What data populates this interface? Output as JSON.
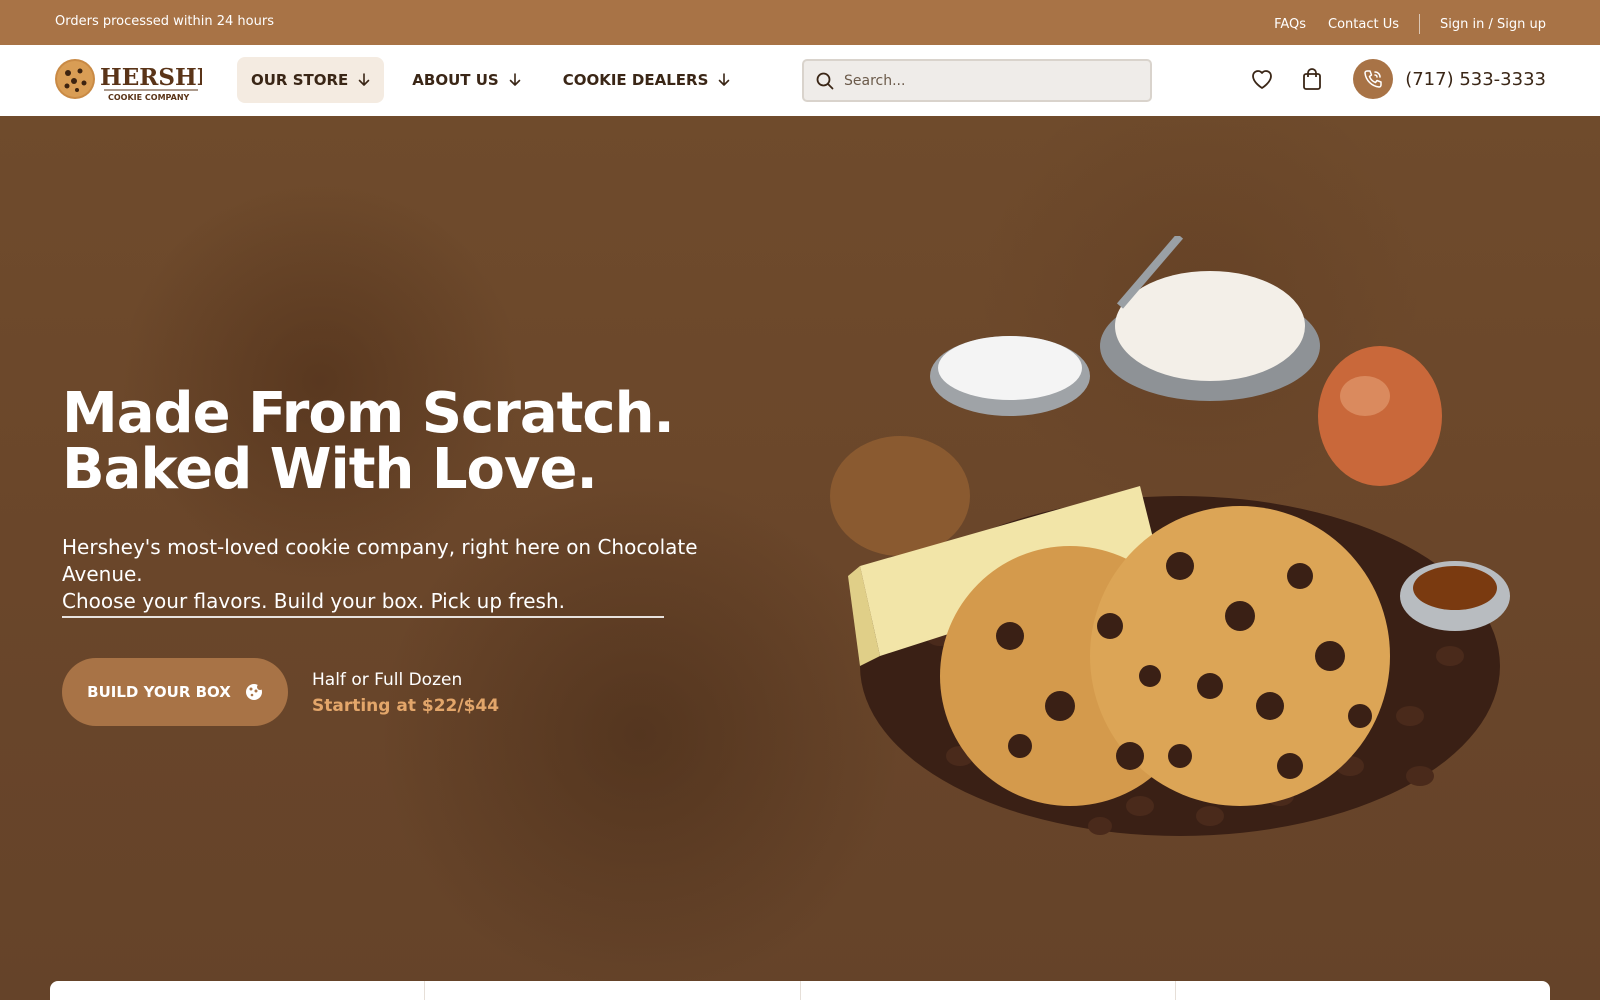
{
  "topbar": {
    "message": "Orders processed within 24 hours",
    "links": [
      "FAQs",
      "Contact Us"
    ],
    "signin": "Sign in / Sign up"
  },
  "logo": {
    "brand": "HERSHEY",
    "tagline": "COOKIE COMPANY"
  },
  "nav": {
    "items": [
      {
        "label": "OUR STORE",
        "active": true
      },
      {
        "label": "ABOUT US",
        "active": false
      },
      {
        "label": "COOKIE DEALERS",
        "active": false
      }
    ]
  },
  "search": {
    "placeholder": "Search..."
  },
  "header_icons": [
    "heart-icon",
    "shopping-bag-icon",
    "phone-icon"
  ],
  "phone": "(717) 533-3333",
  "hero": {
    "title_line1": "Made From Scratch.",
    "title_line2": "Baked With Love.",
    "subtitle_line1": "Hershey's most-loved cookie company, right here on Chocolate Avenue.",
    "subtitle_line2": "Choose your flavors. Build your box. Pick up fresh.",
    "cta_label": "BUILD YOUR BOX",
    "offer_line1": "Half or Full Dozen",
    "offer_line2": "Starting at $22/$44"
  },
  "colors": {
    "accent": "#a87346",
    "hero_bg": "#6f4b2c",
    "offer_text": "#e3a66a",
    "dark_text": "#3a2616"
  }
}
